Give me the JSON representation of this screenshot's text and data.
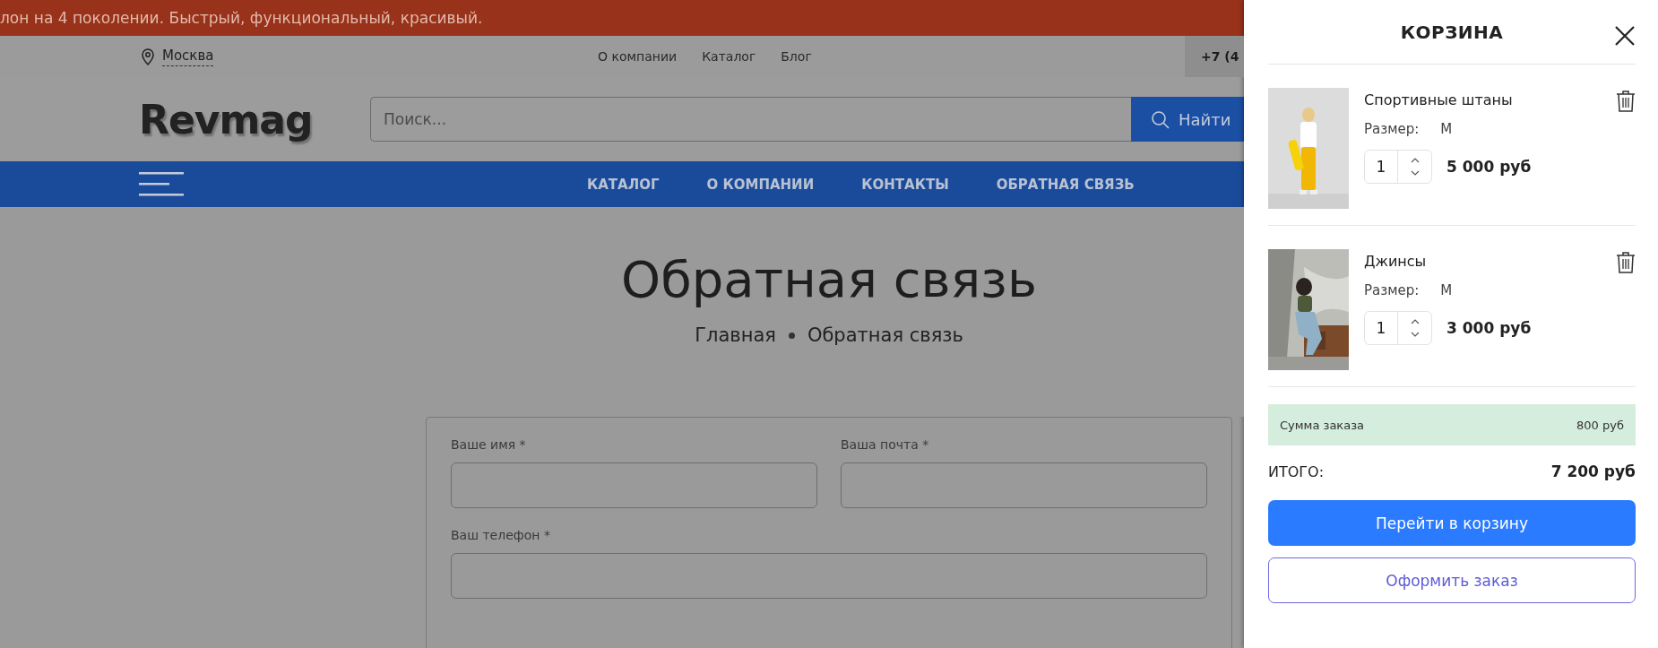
{
  "promo_bar": {
    "text": "лон на 4 поколении. Быстрый, функциональный, красивый."
  },
  "top_bar": {
    "city": "Москва",
    "links": [
      "О компании",
      "Каталог",
      "Блог"
    ],
    "phone": "+7 (4"
  },
  "header": {
    "logo": "Revmag",
    "search": {
      "placeholder": "Поиск...",
      "button": "Найти"
    }
  },
  "nav": {
    "items": [
      "КАТАЛОГ",
      "О КОМПАНИИ",
      "КОНТАКТЫ",
      "ОБРАТНАЯ СВЯЗЬ"
    ]
  },
  "hero": {
    "title": "Обратная связь",
    "breadcrumbs": [
      "Главная",
      "Обратная связь"
    ]
  },
  "form": {
    "fields": [
      {
        "label": "Ваше имя *"
      },
      {
        "label": "Ваша почта *"
      },
      {
        "label": "Ваш телефон *"
      }
    ]
  },
  "cart": {
    "title": "КОРЗИНА",
    "items": [
      {
        "name": "Спортивные штаны",
        "size_label": "Размер:",
        "size": "М",
        "quantity": "1",
        "price": "5 000 руб"
      },
      {
        "name": "Джинсы",
        "size_label": "Размер:",
        "size": "М",
        "quantity": "1",
        "price": "3 000 руб"
      }
    ],
    "order_sum": {
      "label": "Сумма заказа",
      "value": "800 руб"
    },
    "total": {
      "label": "ИТОГО:",
      "value": "7 200 руб"
    },
    "buttons": [
      "Перейти в корзину",
      "Оформить заказ"
    ]
  }
}
